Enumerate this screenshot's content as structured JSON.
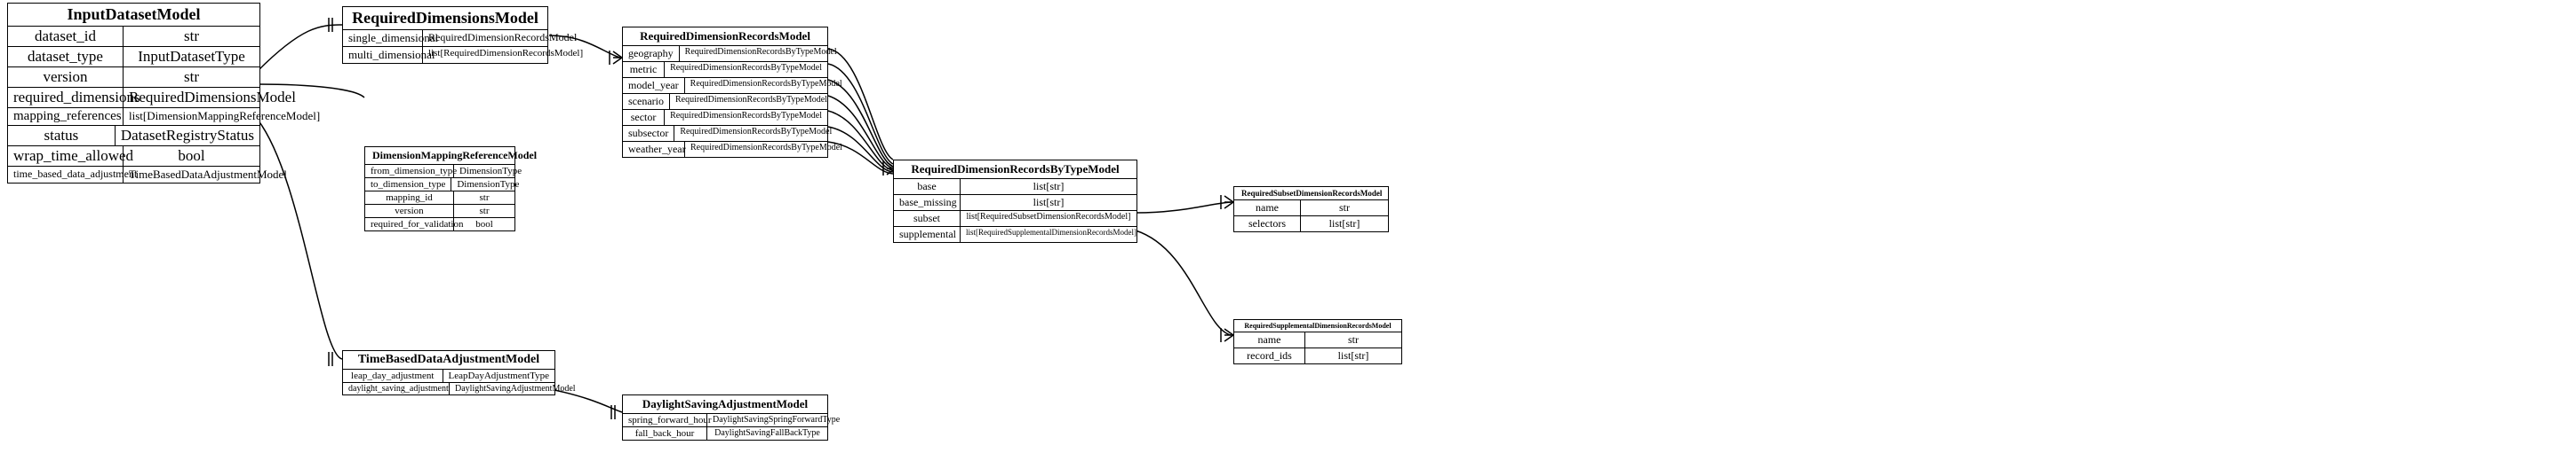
{
  "entities": {
    "InputDatasetModel": {
      "title": "InputDatasetModel",
      "rows": [
        {
          "k": "dataset_id",
          "v": "str"
        },
        {
          "k": "dataset_type",
          "v": "InputDatasetType"
        },
        {
          "k": "version",
          "v": "str"
        },
        {
          "k": "required_dimensions",
          "v": "RequiredDimensionsModel"
        },
        {
          "k": "mapping_references",
          "v": "list[DimensionMappingReferenceModel]"
        },
        {
          "k": "status",
          "v": "DatasetRegistryStatus"
        },
        {
          "k": "wrap_time_allowed",
          "v": "bool"
        },
        {
          "k": "time_based_data_adjustment",
          "v": "TimeBasedDataAdjustmentModel"
        }
      ]
    },
    "RequiredDimensionsModel": {
      "title": "RequiredDimensionsModel",
      "rows": [
        {
          "k": "single_dimensional",
          "v": "RequiredDimensionRecordsModel"
        },
        {
          "k": "multi_dimensional",
          "v": "list[RequiredDimensionRecordsModel]"
        }
      ]
    },
    "DimensionMappingReferenceModel": {
      "title": "DimensionMappingReferenceModel",
      "rows": [
        {
          "k": "from_dimension_type",
          "v": "DimensionType"
        },
        {
          "k": "to_dimension_type",
          "v": "DimensionType"
        },
        {
          "k": "mapping_id",
          "v": "str"
        },
        {
          "k": "version",
          "v": "str"
        },
        {
          "k": "required_for_validation",
          "v": "bool"
        }
      ]
    },
    "TimeBasedDataAdjustmentModel": {
      "title": "TimeBasedDataAdjustmentModel",
      "rows": [
        {
          "k": "leap_day_adjustment",
          "v": "LeapDayAdjustmentType"
        },
        {
          "k": "daylight_saving_adjustment",
          "v": "DaylightSavingAdjustmentModel"
        }
      ]
    },
    "RequiredDimensionRecordsModel": {
      "title": "RequiredDimensionRecordsModel",
      "rows": [
        {
          "k": "geography",
          "v": "RequiredDimensionRecordsByTypeModel"
        },
        {
          "k": "metric",
          "v": "RequiredDimensionRecordsByTypeModel"
        },
        {
          "k": "model_year",
          "v": "RequiredDimensionRecordsByTypeModel"
        },
        {
          "k": "scenario",
          "v": "RequiredDimensionRecordsByTypeModel"
        },
        {
          "k": "sector",
          "v": "RequiredDimensionRecordsByTypeModel"
        },
        {
          "k": "subsector",
          "v": "RequiredDimensionRecordsByTypeModel"
        },
        {
          "k": "weather_year",
          "v": "RequiredDimensionRecordsByTypeModel"
        }
      ]
    },
    "DaylightSavingAdjustmentModel": {
      "title": "DaylightSavingAdjustmentModel",
      "rows": [
        {
          "k": "spring_forward_hour",
          "v": "DaylightSavingSpringForwardType"
        },
        {
          "k": "fall_back_hour",
          "v": "DaylightSavingFallBackType"
        }
      ]
    },
    "RequiredDimensionRecordsByTypeModel": {
      "title": "RequiredDimensionRecordsByTypeModel",
      "rows": [
        {
          "k": "base",
          "v": "list[str]"
        },
        {
          "k": "base_missing",
          "v": "list[str]"
        },
        {
          "k": "subset",
          "v": "list[RequiredSubsetDimensionRecordsModel]"
        },
        {
          "k": "supplemental",
          "v": "list[RequiredSupplementalDimensionRecordsModel]"
        }
      ]
    },
    "RequiredSubsetDimensionRecordsModel": {
      "title": "RequiredSubsetDimensionRecordsModel",
      "rows": [
        {
          "k": "name",
          "v": "str"
        },
        {
          "k": "selectors",
          "v": "list[str]"
        }
      ]
    },
    "RequiredSupplementalDimensionRecordsModel": {
      "title": "RequiredSupplementalDimensionRecordsModel",
      "rows": [
        {
          "k": "name",
          "v": "str"
        },
        {
          "k": "record_ids",
          "v": "list[str]"
        }
      ]
    }
  }
}
